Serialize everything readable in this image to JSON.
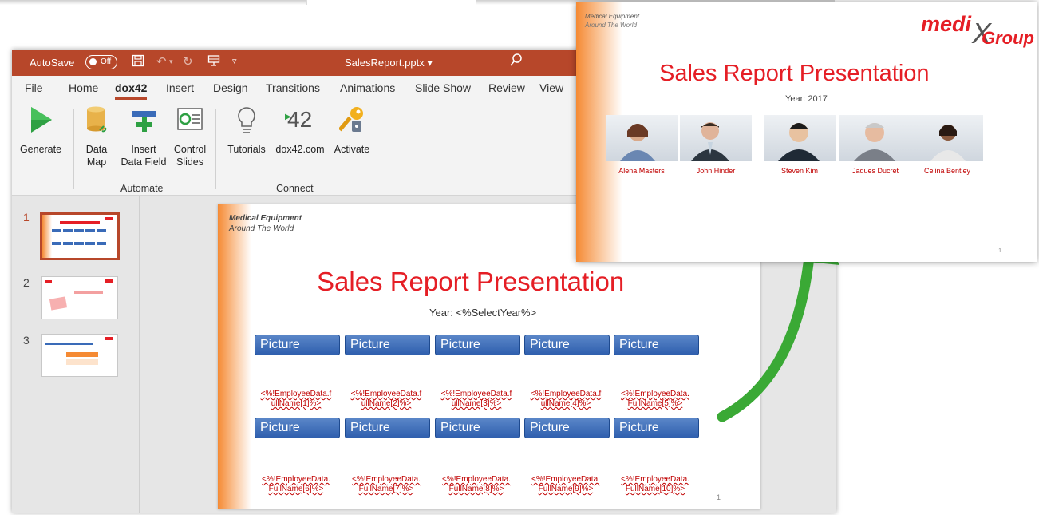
{
  "titlebar": {
    "autosave_label": "AutoSave",
    "autosave_state": "Off",
    "filename": "SalesReport.pptx",
    "filename_caret": "▾"
  },
  "menu": {
    "items": [
      "File",
      "Home",
      "dox42",
      "Insert",
      "Design",
      "Transitions",
      "Animations",
      "Slide Show",
      "Review",
      "View"
    ],
    "active": "dox42"
  },
  "ribbon": {
    "generate": "Generate",
    "data_map": [
      "Data",
      "Map"
    ],
    "insert_field": [
      "Insert",
      "Data Field"
    ],
    "control_slides": [
      "Control",
      "Slides"
    ],
    "tutorials": "Tutorials",
    "dox42_com": "dox42.com",
    "activate": "Activate",
    "group_automate": "Automate",
    "group_connect": "Connect",
    "icon_42": "42"
  },
  "thumbs": [
    {
      "num": "1"
    },
    {
      "num": "2"
    },
    {
      "num": "3"
    }
  ],
  "slide": {
    "sub1": "Medical Equipment",
    "sub2": "Around The World",
    "title": "Sales Report Presentation",
    "year": "Year: <%SelectYear%>",
    "picture_label": "Picture",
    "row1": [
      "<%!EmployeeData.f ullName[1]%>",
      "<%!EmployeeData.f ullName[2]%>",
      "<%!EmployeeData.f ullName[3]%>",
      "<%!EmployeeData.f ullName[4]%>",
      "<%!EmployeeData. FullName[5]%>"
    ],
    "row2": [
      "<%!EmployeeData. FullName[6]%>",
      "<%!EmployeeData. FullName[7]%>",
      "<%!EmployeeData. FullName[8]%>",
      "<%!EmployeeData. FullName[9]%>",
      "<%!EmployeeData. FullName[10]%>"
    ],
    "page_number": "1"
  },
  "result": {
    "sub1": "Medical Equipment",
    "sub2": "Around The World",
    "logo_medi": "medi",
    "logo_x": "X",
    "logo_group": "Group",
    "title": "Sales Report Presentation",
    "year": "Year: 2017",
    "people": [
      "Alena Masters",
      "John Hinder",
      "Steven Kim",
      "Jaques Ducret",
      "Celina Bentley"
    ],
    "page_number": "1"
  },
  "colors": {
    "accent": "#b7472a",
    "title_red": "#e51e25",
    "picture_blue": "#3a6bb8",
    "arrow_green": "#3aa935"
  }
}
